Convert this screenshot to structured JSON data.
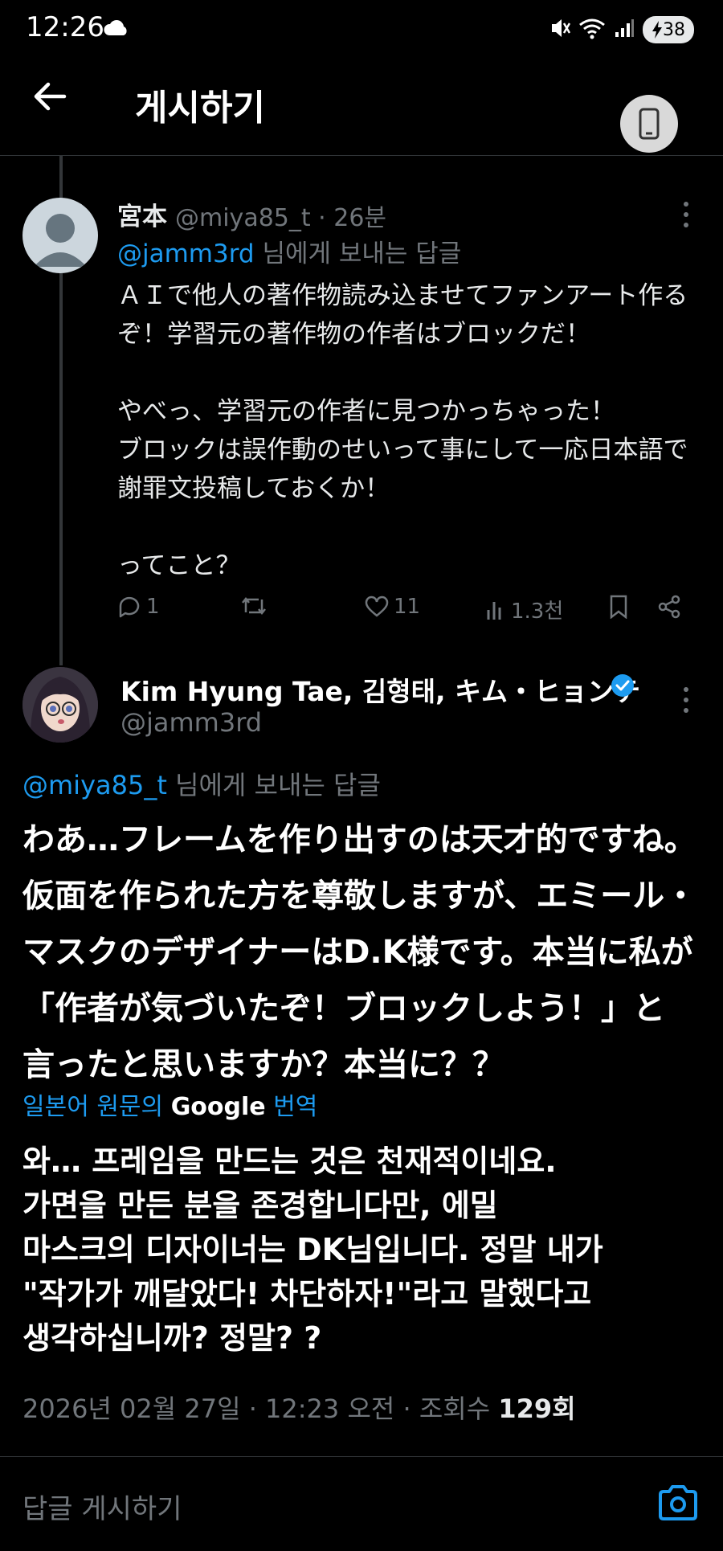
{
  "status_bar": {
    "time": "12:26",
    "battery": "38"
  },
  "header": {
    "title": "게시하기"
  },
  "tweet1": {
    "name": "宮本",
    "handle": "@miya85_t",
    "time_ago": "26분",
    "reply_to_mention": "@jamm3rd",
    "reply_to_suffix": " 님에게 보내는 답글",
    "body": "ＡＩで他人の著作物読み込ませてファンアート作るぞ！学習元の著作物の作者はブロックだ！\n\nやべっ、学習元の作者に見つかっちゃった！\nブロックは誤作動のせいって事にして一応日本語で謝罪文投稿しておくか！\n\nってこと？",
    "replies": "1",
    "likes": "11",
    "views": "1.3천"
  },
  "tweet2": {
    "name": "Kim Hyung Tae, 김형태, キム・ヒョンテ",
    "handle": "@jamm3rd",
    "reply_to_mention": "@miya85_t",
    "reply_to_suffix": " 님에게 보내는 답글",
    "body": "わあ…フレームを作り出すのは天才的ですね。\n仮面を作られた方を尊敬しますが、エミール・\nマスクのデザイナーはD.K様です。本当に私が\n「作者が気づいたぞ！ブロックしよう！」と\n言ったと思いますか？本当に？？",
    "translate_prefix": "일본어 원문의 ",
    "translate_google": "Google",
    "translate_suffix": " 번역",
    "translation": "와… 프레임을 만드는 것은 천재적이네요.\n가면을 만든 분을 존경합니다만, 에밀\n마스크의 디자이너는 DK님입니다. 정말 내가\n\"작가가 깨달았다! 차단하자!\"라고 말했다고\n생각하십니까? 정말? ?",
    "timestamp": "2026년 02월 27일 · 12:23 오전 · 조회수 ",
    "views": "129회"
  },
  "reply_bar": {
    "placeholder": "답글 게시하기"
  },
  "colors": {
    "accent": "#1d9bf0",
    "muted": "#71767b",
    "background": "#000000"
  }
}
